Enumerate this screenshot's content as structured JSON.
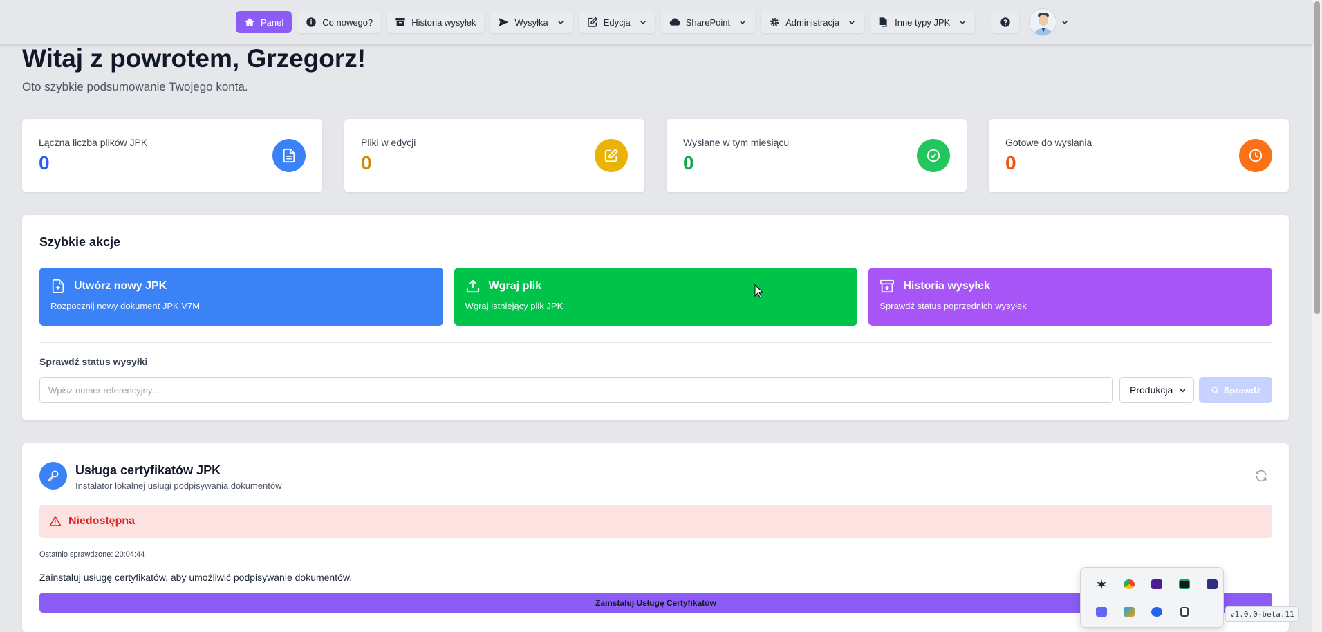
{
  "nav": {
    "items": [
      {
        "label": "Panel",
        "icon": "home-icon",
        "active": true,
        "dropdown": false
      },
      {
        "label": "Co nowego?",
        "icon": "info-icon",
        "active": false,
        "dropdown": false
      },
      {
        "label": "Historia wysyłek",
        "icon": "archive-icon",
        "active": false,
        "dropdown": false
      },
      {
        "label": "Wysyłka",
        "icon": "send-icon",
        "active": false,
        "dropdown": true
      },
      {
        "label": "Edycja",
        "icon": "edit-icon",
        "active": false,
        "dropdown": true
      },
      {
        "label": "SharePoint",
        "icon": "cloud-icon",
        "active": false,
        "dropdown": true
      },
      {
        "label": "Administracja",
        "icon": "gear-icon",
        "active": false,
        "dropdown": true
      },
      {
        "label": "Inne typy JPK",
        "icon": "copy-icon",
        "active": false,
        "dropdown": true
      }
    ],
    "help_icon": "question-circle-icon",
    "avatar_icon": "user-avatar-icon"
  },
  "greeting": {
    "title": "Witaj z powrotem, Grzegorz!",
    "subtitle": "Oto szybkie podsumowanie Twojego konta."
  },
  "stats": [
    {
      "label": "Łączna liczba plików JPK",
      "value": "0",
      "color": "#2563eb",
      "icon_bg": "#3b82f6",
      "icon": "file-icon"
    },
    {
      "label": "Pliki w edycji",
      "value": "0",
      "color": "#ca8a04",
      "icon_bg": "#eab308",
      "icon": "edit-icon"
    },
    {
      "label": "Wysłane w tym miesiącu",
      "value": "0",
      "color": "#16a34a",
      "icon_bg": "#22c55e",
      "icon": "check-circle-icon"
    },
    {
      "label": "Gotowe do wysłania",
      "value": "0",
      "color": "#ea580c",
      "icon_bg": "#f97316",
      "icon": "clock-icon"
    }
  ],
  "quick_actions": {
    "title": "Szybkie akcje",
    "buttons": [
      {
        "title": "Utwórz nowy JPK",
        "desc": "Rozpocznij nowy dokument JPK V7M",
        "color": "#3b82f6",
        "icon": "file-plus-icon"
      },
      {
        "title": "Wgraj plik",
        "desc": "Wgraj istniejący plik JPK",
        "color": "#00c44a",
        "icon": "upload-icon"
      },
      {
        "title": "Historia wysyłek",
        "desc": "Sprawdź status poprzednich wysyłek",
        "color": "#a855f7",
        "icon": "archive-icon"
      }
    ],
    "status_label": "Sprawdź status wysyłki",
    "ref_placeholder": "Wpisz numer referencyjny...",
    "ref_value": "",
    "environment": "Produkcja",
    "check_label": "Sprawdź"
  },
  "cert_service": {
    "title": "Usługa certyfikatów JPK",
    "subtitle": "Instalator lokalnej usługi podpisywania dokumentów",
    "status": "Niedostępna",
    "last_checked": "Ostatnio sprawdzone: 20:04:44",
    "message": "Zainstaluj usługę certyfikatów, aby umożliwić podpisywanie dokumentów.",
    "install_label": "Zainstaluj Usługę Certyfikatów"
  },
  "tray": {
    "icons": [
      {
        "name": "asterisk-app-icon",
        "color": "#1f2937"
      },
      {
        "name": "chrome-icon",
        "color": "#ea4335"
      },
      {
        "name": "obs-streaming-icon",
        "color": "#4c1d95"
      },
      {
        "name": "nvidia-icon",
        "color": "#16a34a"
      },
      {
        "name": "quote-app-icon",
        "color": "#312e81"
      },
      {
        "name": "teams-icon",
        "color": "#6366f1"
      },
      {
        "name": "security-shield-icon",
        "color": "#0ea5e9"
      },
      {
        "name": "bluetooth-icon",
        "color": "#2563eb"
      },
      {
        "name": "usb-eject-icon",
        "color": "#374151"
      }
    ]
  },
  "version": "v1.0.0-beta.11"
}
